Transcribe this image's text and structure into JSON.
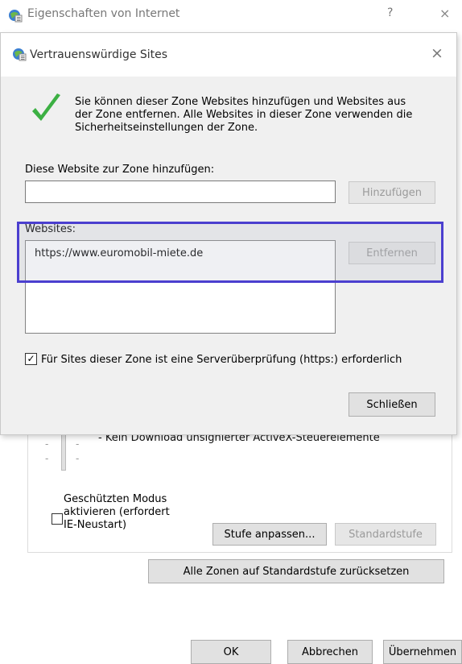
{
  "parent_window": {
    "title": "Eigenschaften von Internet",
    "help_glyph": "?",
    "close_glyph": "×",
    "partial_text": "- Kein Download unsignierter ActiveX-Steuerelemente",
    "protected_mode_label": "Geschützten Modus aktivieren (erfordert IE-Neustart)",
    "protected_mode_lines": [
      "Geschützten Modus",
      "aktivieren (erfordert",
      "IE-Neustart)"
    ],
    "custom_level_button": "Stufe anpassen...",
    "default_level_button": "Standardstufe",
    "reset_all_button": "Alle Zonen auf Standardstufe zurücksetzen",
    "ok_button": "OK",
    "cancel_button": "Abbrechen",
    "apply_button": "Übernehmen"
  },
  "dialog": {
    "title": "Vertrauenswürdige Sites",
    "close_glyph": "×",
    "info_lines": [
      "Sie können dieser Zone Websites hinzufügen und Websites aus",
      "der Zone entfernen. Alle Websites in dieser Zone verwenden die",
      "Sicherheitseinstellungen der Zone."
    ],
    "add_label": "Diese Website zur Zone hinzufügen:",
    "add_input_value": "",
    "add_button": "Hinzufügen",
    "websites_label": "Websites:",
    "websites": [
      "https://www.euromobil-miete.de"
    ],
    "remove_button": "Entfernen",
    "https_checkbox_label": "Für Sites dieser Zone ist eine Serverüberprüfung (https:) erforderlich",
    "https_checked": true,
    "close_button": "Schließen"
  },
  "colors": {
    "highlight_border": "#4b3fcf",
    "checkmark": "#3cb043"
  },
  "icons": [
    "ie-globe-icon",
    "checkmark-icon",
    "close-icon"
  ]
}
